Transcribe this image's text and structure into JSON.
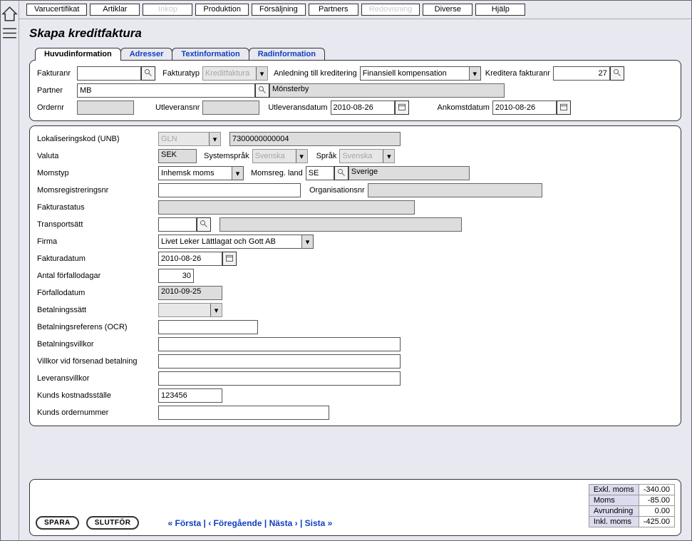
{
  "top_menu": {
    "items": [
      {
        "label": "Varucertifikat",
        "disabled": false
      },
      {
        "label": "Artiklar",
        "disabled": false
      },
      {
        "label": "Inköp",
        "disabled": true
      },
      {
        "label": "Produktion",
        "disabled": false
      },
      {
        "label": "Försäljning",
        "disabled": false
      },
      {
        "label": "Partners",
        "disabled": false
      },
      {
        "label": "Redovisning",
        "disabled": true
      },
      {
        "label": "Diverse",
        "disabled": false
      },
      {
        "label": "Hjälp",
        "disabled": false
      }
    ]
  },
  "page_title": "Skapa kreditfaktura",
  "tabs": [
    {
      "label": "Huvudinformation",
      "active": true
    },
    {
      "label": "Adresser",
      "active": false
    },
    {
      "label": "Textinformation",
      "active": false
    },
    {
      "label": "Radinformation",
      "active": false
    }
  ],
  "header": {
    "fakturanr_label": "Fakturanr",
    "fakturanr_value": "",
    "fakturatyp_label": "Fakturatyp",
    "fakturatyp_value": "Kreditfaktura",
    "anledning_label": "Anledning till kreditering",
    "anledning_value": "Finansiell kompensation",
    "kreditera_label": "Kreditera fakturanr",
    "kreditera_value": "27",
    "partner_label": "Partner",
    "partner_value": "MB",
    "partner_name": "Mönsterby",
    "ordernr_label": "Ordernr",
    "ordernr_value": "",
    "utleveransnr_label": "Utleveransnr",
    "utleveransnr_value": "",
    "utleveransdatum_label": "Utleveransdatum",
    "utleveransdatum_value": "2010-08-26",
    "ankomstdatum_label": "Ankomstdatum",
    "ankomstdatum_value": "2010-08-26"
  },
  "body": {
    "lokaliseringskod_label": "Lokaliseringskod (UNB)",
    "lokaliseringskod_type": "GLN",
    "lokaliseringskod_value": "7300000000004",
    "valuta_label": "Valuta",
    "valuta_value": "SEK",
    "systemsprak_label": "Systemspråk",
    "systemsprak_value": "Svenska",
    "sprak_label": "Språk",
    "sprak_value": "Svenska",
    "momstyp_label": "Momstyp",
    "momstyp_value": "Inhemsk moms",
    "momsreg_land_label": "Momsreg. land",
    "momsreg_land_value": "SE",
    "momsreg_land_name": "Sverige",
    "momsregnr_label": "Momsregistreringsnr",
    "momsregnr_value": "",
    "orgnr_label": "Organisationsnr",
    "orgnr_value": "",
    "fakturastatus_label": "Fakturastatus",
    "fakturastatus_value": "",
    "transportsatt_label": "Transportsätt",
    "transportsatt_code": "",
    "transportsatt_name": "",
    "firma_label": "Firma",
    "firma_value": "Livet Leker Lättlagat och Gott AB",
    "fakturadatum_label": "Fakturadatum",
    "fakturadatum_value": "2010-08-26",
    "antal_forfallodagar_label": "Antal förfallodagar",
    "antal_forfallodagar_value": "30",
    "forfallodatum_label": "Förfallodatum",
    "forfallodatum_value": "2010-09-25",
    "betalningssatt_label": "Betalningssätt",
    "betalningssatt_value": "",
    "betalningsreferens_label": "Betalningsreferens (OCR)",
    "betalningsreferens_value": "",
    "betalningsvillkor_label": "Betalningsvillkor",
    "betalningsvillkor_value": "",
    "villkor_forsenad_label": "Villkor vid försenad betalning",
    "villkor_forsenad_value": "",
    "leveransvillkor_label": "Leveransvillkor",
    "leveransvillkor_value": "",
    "kunds_kostnadsstalle_label": "Kunds kostnadsställe",
    "kunds_kostnadsstalle_value": "123456",
    "kunds_ordernummer_label": "Kunds ordernummer",
    "kunds_ordernummer_value": ""
  },
  "totals": {
    "exkl_moms_label": "Exkl. moms",
    "exkl_moms_value": "-340.00",
    "moms_label": "Moms",
    "moms_value": "-85.00",
    "avrundning_label": "Avrundning",
    "avrundning_value": "0.00",
    "inkl_moms_label": "Inkl. moms",
    "inkl_moms_value": "-425.00"
  },
  "footer": {
    "spara": "SPARA",
    "slutfor": "SLUTFÖR",
    "nav_first": "« Första",
    "nav_prev": "‹ Föregående",
    "nav_next": "Nästa ›",
    "nav_last": "Sista »"
  }
}
